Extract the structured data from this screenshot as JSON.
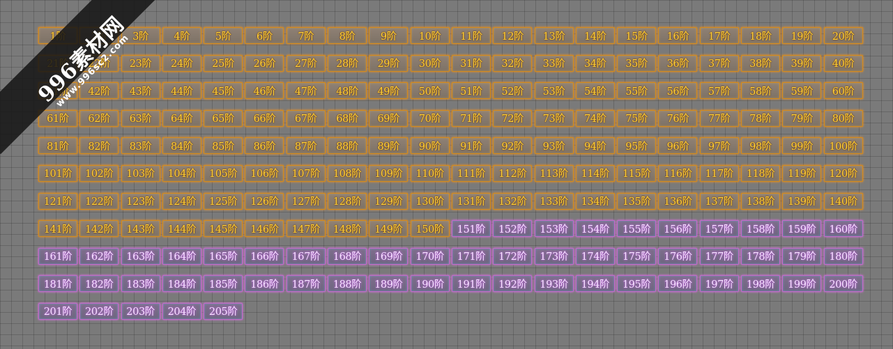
{
  "watermark": {
    "name": "996素材网",
    "url": "www.996sc2.com"
  },
  "tiers": {
    "suffix": "阶",
    "first": 1,
    "last": 205,
    "per_row": 20,
    "gold_range": [
      1,
      150
    ],
    "purple_range": [
      151,
      205
    ]
  },
  "colors": {
    "gold_text": "#ffd238",
    "gold_border": "#d48a1a",
    "purple_text": "#f6e6ff",
    "purple_border": "#c26ac8",
    "background": "#7a7a7a"
  }
}
